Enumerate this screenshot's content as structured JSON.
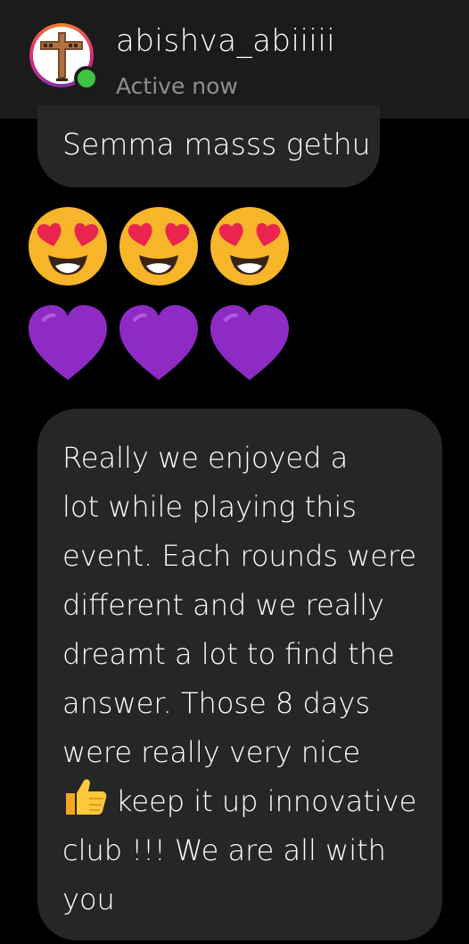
{
  "header": {
    "username": "abishva_abiiiii",
    "status": "Active now",
    "online_color": "#3ec43e"
  },
  "messages": {
    "first": "Semma masss gethu",
    "emoji_rows": [
      {
        "icon": "heart-eyes-emoji",
        "count": 3
      },
      {
        "icon": "purple-heart-emoji",
        "count": 3
      }
    ],
    "long_message_lines": [
      "Really we enjoyed a",
      "lot while playing this",
      "event. Each rounds were",
      "different and we really",
      "dreamt a lot to find the",
      "answer. Those 8 days",
      "were really very nice",
      "keep it up innovative",
      "club !!! We are all with",
      "you"
    ],
    "thumbs_icon": "thumbs-up-emoji"
  },
  "colors": {
    "background": "#000000",
    "header_bg": "#1b1b1b",
    "bubble_bg": "#262626",
    "status_text": "#8e8e8e"
  }
}
